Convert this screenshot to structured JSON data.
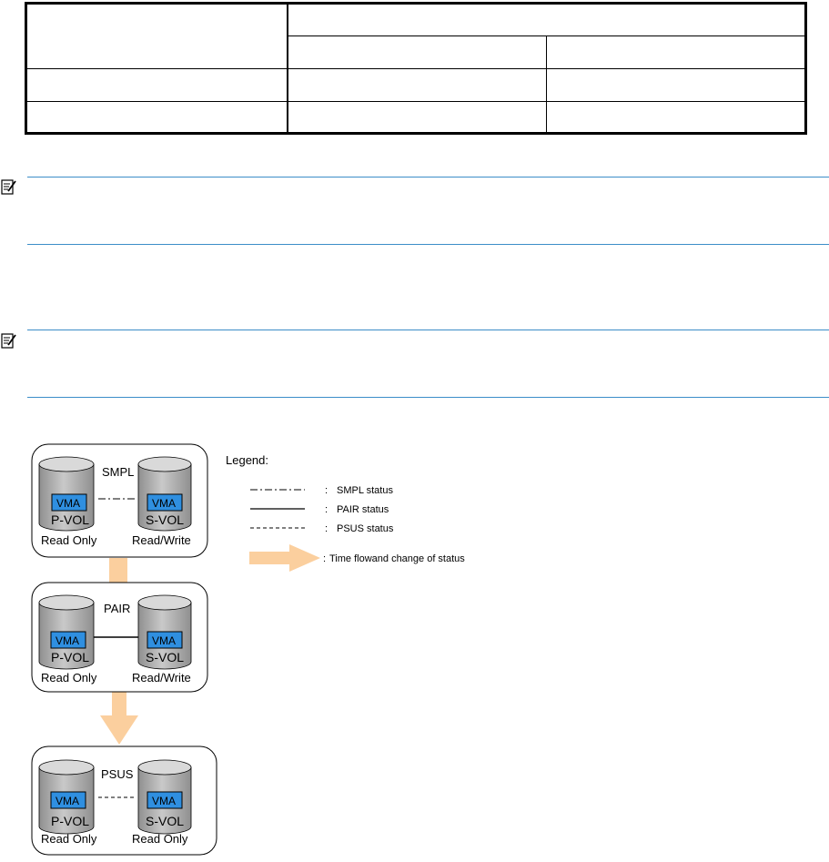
{
  "table": {
    "rows": 4,
    "columns": 3
  },
  "notes": [
    {
      "icon": "note-icon"
    },
    {
      "icon": "note-icon"
    }
  ],
  "diagram": {
    "states": [
      {
        "status": "SMPL",
        "left_vol": "P-VOL",
        "right_vol": "S-VOL",
        "left_badge": "VMA",
        "right_badge": "VMA",
        "left_access": "Read Only",
        "right_access": "Read/Write",
        "link": "dash-dot"
      },
      {
        "status": "PAIR",
        "left_vol": "P-VOL",
        "right_vol": "S-VOL",
        "left_badge": "VMA",
        "right_badge": "VMA",
        "left_access": "Read Only",
        "right_access": "Read/Write",
        "link": "solid"
      },
      {
        "status": "PSUS",
        "left_vol": "P-VOL",
        "right_vol": "S-VOL",
        "left_badge": "VMA",
        "right_badge": "VMA",
        "left_access": "Read Only",
        "right_access": "Read Only",
        "link": "dashed"
      }
    ],
    "legend": {
      "title": "Legend:",
      "items": [
        {
          "sep": ":",
          "text": "SMPL status",
          "style": "dash-dot"
        },
        {
          "sep": ":",
          "text": "PAIR status",
          "style": "solid"
        },
        {
          "sep": ":",
          "text": "PSUS status",
          "style": "dashed"
        },
        {
          "sep": ":",
          "text": "Time flowand change of status",
          "style": "arrow"
        }
      ]
    },
    "colors": {
      "arrow": "#fbcf9e",
      "badge": "#2f8fe0",
      "cylinder": "#b4b4b4",
      "rule": "#3c8dc8"
    }
  }
}
